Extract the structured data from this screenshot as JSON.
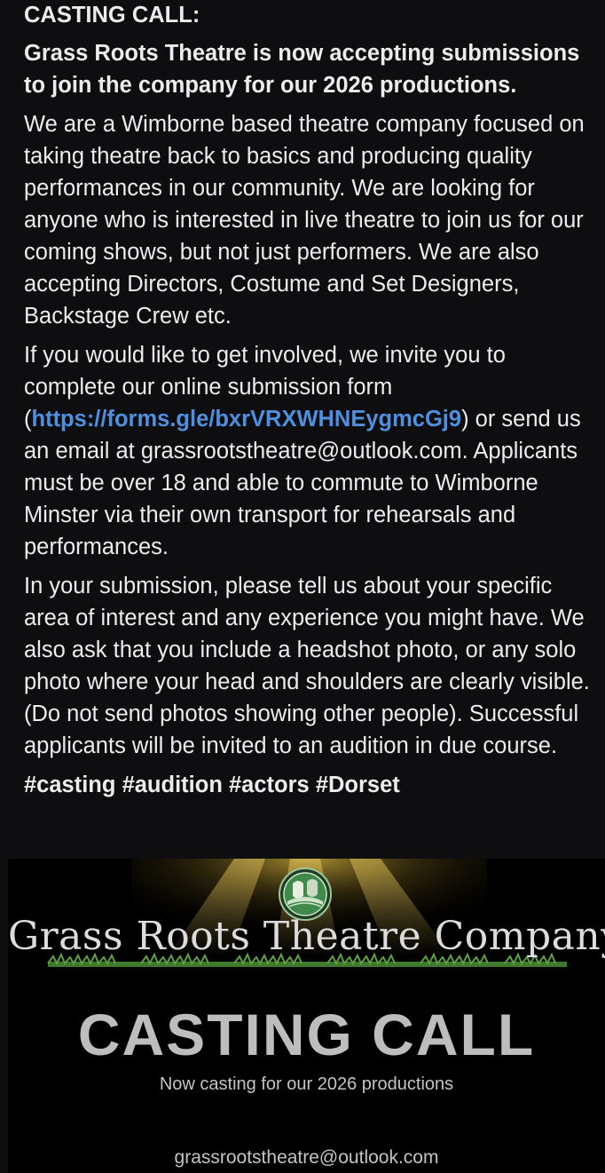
{
  "post": {
    "title": "CASTING CALL:",
    "lead": "Grass Roots Theatre is now accepting submissions to join the company for our 2026 productions.",
    "para1": "We are a Wimborne based theatre company focused on taking theatre back to basics and producing quality performances in our community. We are looking for anyone who is interested in live theatre to join us for our coming shows, but not just performers. We are also accepting Directors, Costume and Set Designers, Backstage Crew etc.",
    "para2_before": "If you would like to get involved, we invite you to complete our online submission form (",
    "link_text": "https://forms.gle/bxrVRXWHNEygmcGj9",
    "para2_after": ") or send us an email at grassrootstheatre@outlook.com. Applicants must be over 18 and able to commute to Wimborne Minster via their own transport for rehearsals and performances.",
    "para3": "In your submission, please tell us about your specific area of interest and any experience you might have. We also ask that you include a headshot photo, or any solo photo where your head and shoulders are clearly visible. (Do not send photos showing other people). Successful applicants will be invited to an audition in due course.",
    "hashtags": [
      "#casting",
      "#audition",
      "#actors",
      "#Dorset"
    ]
  },
  "banner": {
    "company_name": "Grass Roots Theatre Company",
    "headline": "CASTING CALL",
    "subline": "Now casting for our 2026 productions",
    "email": "grassrootstheatre@outlook.com",
    "logo_icon": "theatre-mask-globe-logo",
    "colors": {
      "spotlight": "#b89a2e",
      "logo_green": "#3f8a4a",
      "grass": "#3d7a2e"
    }
  }
}
